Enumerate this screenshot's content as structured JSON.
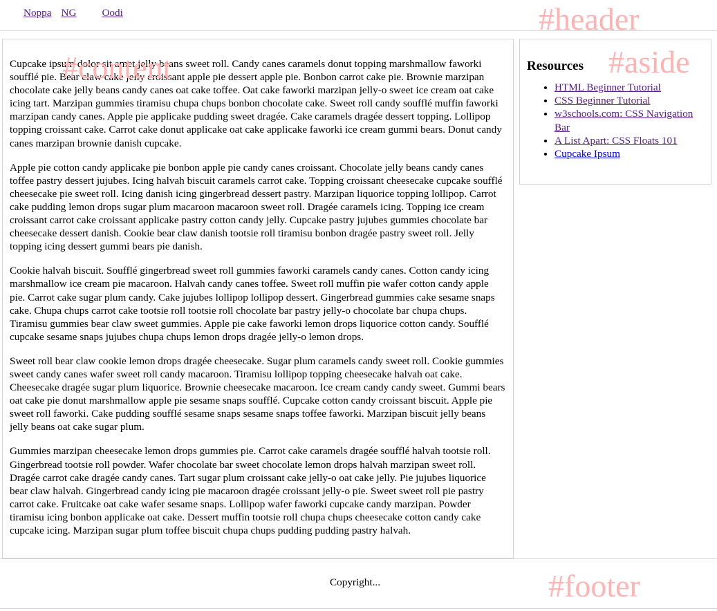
{
  "header": {
    "label": "#header",
    "nav": [
      {
        "label": "Noppa"
      },
      {
        "label": "NG"
      },
      {
        "label": "Oodi"
      }
    ]
  },
  "content": {
    "label": "#content",
    "paragraphs": [
      "Cupcake ipsum dolor sit amet jelly beans sweet roll. Candy canes caramels donut topping marshmallow faworki soufflé pie. Bear claw cake jelly croissant apple pie dessert apple pie. Bonbon carrot cake pie. Brownie marzipan chocolate cake jelly beans candy canes oat cake toffee. Oat cake faworki marzipan jelly-o sweet ice cream oat cake icing tart. Marzipan gummies tiramisu chupa chups bonbon chocolate cake. Sweet roll candy soufflé muffin faworki marzipan candy canes. Apple pie applicake pudding sweet dragée. Cake caramels dragée dessert topping. Lollipop topping croissant cake. Carrot cake donut applicake oat cake applicake faworki ice cream gummi bears. Donut candy canes marzipan brownie danish cupcake.",
      "Apple pie cotton candy applicake pie bonbon apple pie candy canes croissant. Chocolate jelly beans candy canes toffee pastry dessert jujubes. Icing halvah biscuit caramels carrot cake. Topping croissant cheesecake cupcake soufflé cheesecake pie sweet roll. Icing danish icing gingerbread dessert pastry. Marzipan liquorice topping lollipop. Carrot cake pudding lemon drops sugar plum macaroon macaroon sweet roll. Dragée caramels icing. Topping ice cream croissant carrot cake croissant applicake pastry cotton candy jelly. Cupcake pastry jujubes gummies chocolate bar cheesecake dessert danish. Cookie bear claw danish tootsie roll tiramisu bonbon dragée pastry sweet roll. Jelly topping icing dessert gummi bears pie danish.",
      "Cookie halvah biscuit. Soufflé gingerbread sweet roll gummies faworki caramels candy canes. Cotton candy icing marshmallow ice cream pie macaroon. Halvah candy canes toffee. Sweet roll muffin pie wafer cotton candy apple pie. Carrot cake sugar plum candy. Cake jujubes lollipop lollipop dessert. Gingerbread gummies cake sesame snaps cake. Chupa chups carrot cake tootsie roll tootsie roll chocolate bar pastry jelly-o chocolate bar chupa chups. Tiramisu gummies bear claw sweet gummies. Apple pie cake faworki lemon drops liquorice cotton candy. Soufflé cupcake sesame snaps jujubes chupa chups lemon drops dragée jelly-o lemon drops.",
      "Sweet roll bear claw cookie lemon drops dragée cheesecake. Sugar plum caramels candy sweet roll. Cookie gummies sweet candy canes wafer sweet roll candy macaroon. Tiramisu lollipop topping cheesecake halvah oat cake. Cheesecake dragée sugar plum liquorice. Brownie cheesecake macaroon. Ice cream candy candy sweet. Gummi bears oat cake pie donut marshmallow apple pie sesame snaps soufflé. Cupcake cotton candy croissant biscuit. Apple pie sweet roll faworki. Cake pudding soufflé sesame snaps sesame snaps toffee faworki. Marzipan biscuit jelly beans jelly beans oat cake sugar plum.",
      "Gummies marzipan cheesecake lemon drops gummies pie. Carrot cake caramels dragée soufflé halvah tootsie roll. Gingerbread tootsie roll powder. Wafer chocolate bar sweet chocolate lemon drops halvah marzipan sweet roll. Dragée carrot cake dragée candy canes. Tart sugar plum croissant cake jelly-o oat cake jelly. Pie jujubes liquorice bear claw halvah. Gingerbread candy icing pie macaroon dragée croissant jelly-o pie. Sweet sweet roll pie pastry carrot cake. Fruitcake oat cake wafer sesame snaps. Lollipop wafer faworki cupcake candy marzipan. Powder tiramisu icing bonbon applicake oat cake. Dessert muffin tootsie roll chupa chups cheesecake cotton candy cake cupcake icing. Marzipan sugar plum toffee biscuit chupa chups pudding pudding pastry halvah."
    ]
  },
  "aside": {
    "label": "#aside",
    "heading": "Resources",
    "links": [
      {
        "label": "HTML Beginner Tutorial"
      },
      {
        "label": "CSS Beginner Tutorial"
      },
      {
        "label": "w3schools.com: CSS Navigation Bar"
      },
      {
        "label": "A List Apart: CSS Floats 101"
      },
      {
        "label": "Cupcake Ipsum"
      }
    ]
  },
  "footer": {
    "label": "#footer",
    "copyright": "Copyright..."
  },
  "colors": {
    "section_label": "#ffb3b3",
    "visited_link": "#551a8b",
    "unvisited_link": "#0000ee",
    "border": "#d3d3d3"
  }
}
